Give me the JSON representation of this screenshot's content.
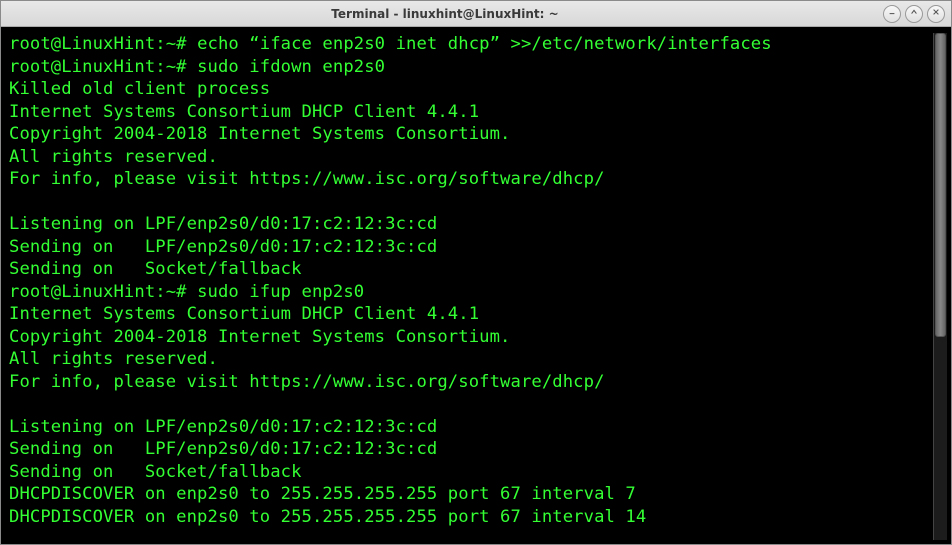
{
  "window": {
    "title": "Terminal - linuxhint@LinuxHint: ~"
  },
  "prompt": {
    "user_host": "root@LinuxHint",
    "path": "~",
    "symbol": "#"
  },
  "lines": {
    "l0_prompt": "root@LinuxHint:~# ",
    "l0_cmd": "echo “iface enp2s0 inet dhcp” >>/etc/network/interfaces",
    "l1_prompt": "root@LinuxHint:~# ",
    "l1_cmd": "sudo ifdown enp2s0",
    "l2": "Killed old client process",
    "l3": "Internet Systems Consortium DHCP Client 4.4.1",
    "l4": "Copyright 2004-2018 Internet Systems Consortium.",
    "l5": "All rights reserved.",
    "l6": "For info, please visit https://www.isc.org/software/dhcp/",
    "l7": "",
    "l8": "Listening on LPF/enp2s0/d0:17:c2:12:3c:cd",
    "l9": "Sending on   LPF/enp2s0/d0:17:c2:12:3c:cd",
    "l10": "Sending on   Socket/fallback",
    "l11_prompt": "root@LinuxHint:~# ",
    "l11_cmd": "sudo ifup enp2s0",
    "l12": "Internet Systems Consortium DHCP Client 4.4.1",
    "l13": "Copyright 2004-2018 Internet Systems Consortium.",
    "l14": "All rights reserved.",
    "l15": "For info, please visit https://www.isc.org/software/dhcp/",
    "l16": "",
    "l17": "Listening on LPF/enp2s0/d0:17:c2:12:3c:cd",
    "l18": "Sending on   LPF/enp2s0/d0:17:c2:12:3c:cd",
    "l19": "Sending on   Socket/fallback",
    "l20": "DHCPDISCOVER on enp2s0 to 255.255.255.255 port 67 interval 7",
    "l21": "DHCPDISCOVER on enp2s0 to 255.255.255.255 port 67 interval 14"
  },
  "colors": {
    "terminal_bg": "#000000",
    "terminal_fg": "#33ff33"
  }
}
